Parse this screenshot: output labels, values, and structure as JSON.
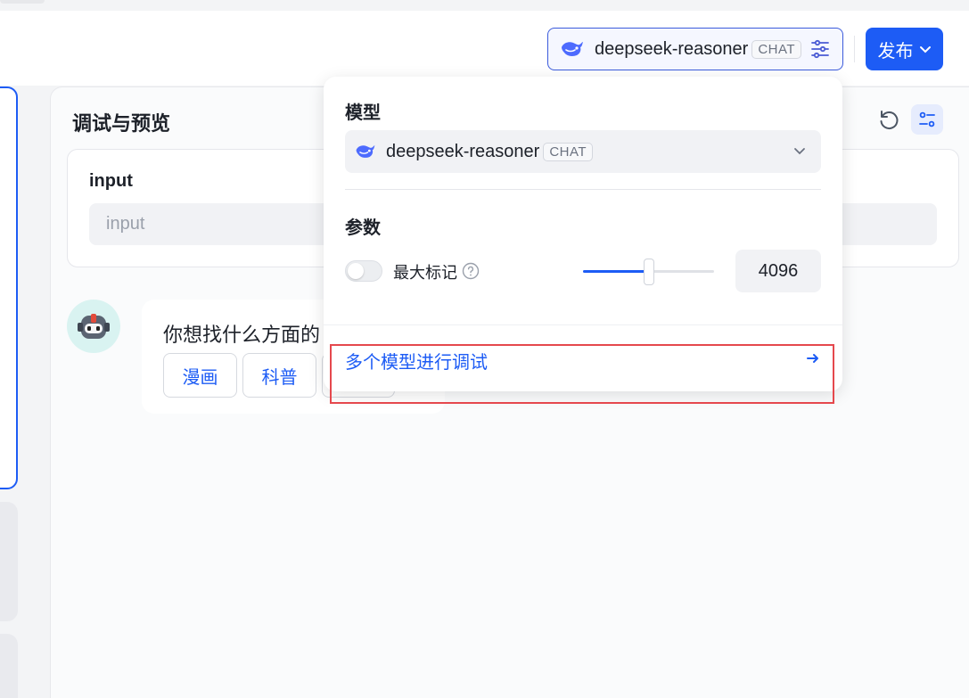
{
  "header": {
    "model_name": "deepseek-reasoner",
    "model_tag": "CHAT",
    "publish_label": "发布"
  },
  "preview": {
    "title": "调试与预览",
    "input_label": "input",
    "input_placeholder": "input",
    "bot_message": "你想找什么方面的",
    "chips": [
      "漫画",
      "科普"
    ]
  },
  "popover": {
    "model_section_title": "模型",
    "selected_model": "deepseek-reasoner",
    "selected_model_tag": "CHAT",
    "params_section_title": "参数",
    "max_tokens_label": "最大标记",
    "max_tokens_enabled": false,
    "max_tokens_value": "4096",
    "slider_fraction": 0.5,
    "multi_model_link": "多个模型进行调试"
  },
  "colors": {
    "accent": "#1d5cf5",
    "highlight_box": "#e5484d"
  },
  "icons": [
    "deepseek-whale-icon",
    "tune-icon",
    "chevron-down-icon",
    "reset-icon",
    "settings-icon",
    "robot-avatar-icon",
    "help-icon",
    "arrow-right-icon"
  ]
}
